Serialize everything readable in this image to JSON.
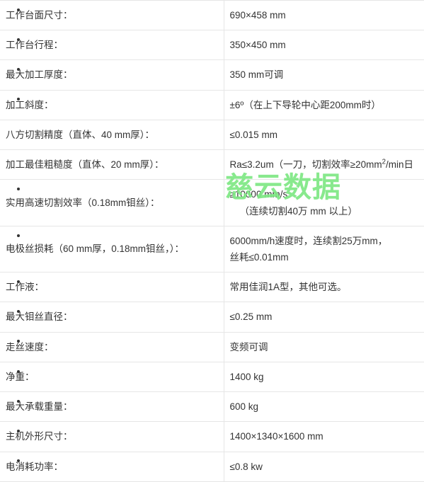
{
  "table": {
    "rows": [
      {
        "bulleted": true,
        "label": "工作台面尺寸：",
        "value": "690×458 mm"
      },
      {
        "bulleted": true,
        "label": "工作台行程：",
        "value": "350×450 mm"
      },
      {
        "bulleted": true,
        "label": "最大加工厚度：",
        "value": "350 mm可调"
      },
      {
        "bulleted": true,
        "label": "加工斜度：",
        "value": "±6º（在上下导轮中心距200mm时）"
      },
      {
        "bulleted": false,
        "label": "八方切割精度（直体、40 mm厚）：",
        "value": "≤0.015 mm"
      },
      {
        "bulleted": false,
        "label": "加工最佳粗糙度（直体、20 mm厚）：",
        "value_pre": "Ra≤3.2um（一刀，切割效率≥20mm",
        "value_sup": "2",
        "value_post": "/min日"
      },
      {
        "bulleted": true,
        "label": "实用高速切割效率（0.18mm钼丝）：",
        "value": "≥10000 mm/s",
        "value_line2": "（连续切割40万 mm 以上）"
      },
      {
        "bulleted": true,
        "label": "电极丝损耗（60 mm厚，0.18mm钼丝，）：",
        "value": "6000mm/h速度时，连续割25万mm，",
        "value_line2": "丝耗≤0.01mm"
      },
      {
        "bulleted": true,
        "label": "工作液：",
        "value": "常用佳润1A型，其他可选。"
      },
      {
        "bulleted": true,
        "label": "最大钼丝直径：",
        "value": "≤0.25 mm"
      },
      {
        "bulleted": true,
        "label": "走丝速度：",
        "value": "变频可调"
      },
      {
        "bulleted": true,
        "label": "净重：",
        "value": "1400 kg"
      },
      {
        "bulleted": true,
        "label": "最大承载重量：",
        "value": "600 kg"
      },
      {
        "bulleted": true,
        "label": "主机外形尺寸：",
        "value": "1400×1340×1600 mm"
      },
      {
        "bulleted": true,
        "label": "电消耗功率：",
        "value": "≤0.8 kw"
      }
    ]
  },
  "watermark": {
    "text": "慈云数据",
    "color": "#7ee884"
  }
}
